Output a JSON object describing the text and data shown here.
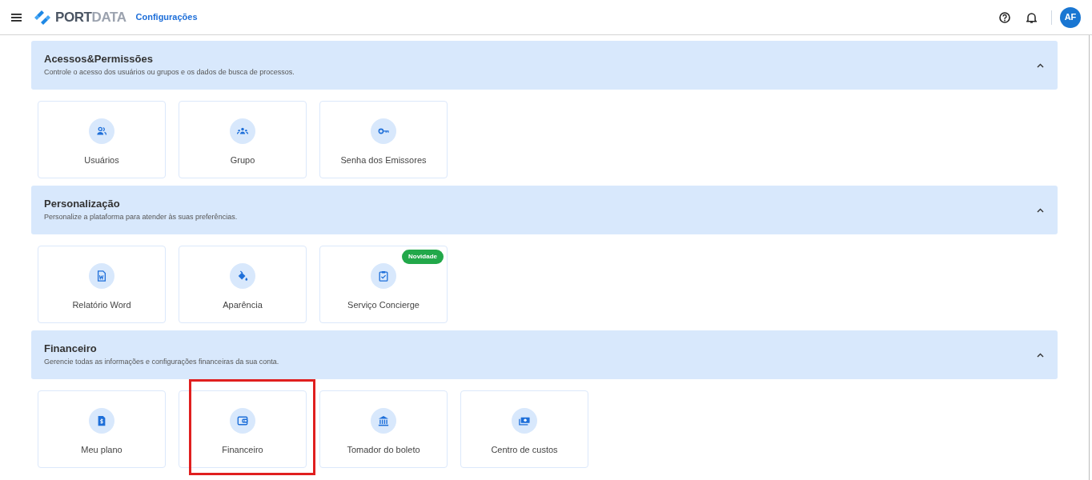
{
  "header": {
    "brand": "PORTDATA",
    "page_title": "Configurações",
    "avatar": "AF"
  },
  "sections": [
    {
      "title": "Acessos&Permissões",
      "subtitle": "Controle o acesso dos usuários ou grupos e os dados de busca de processos.",
      "expanded": true,
      "cards": [
        {
          "label": "Usuários",
          "highlighted": false
        },
        {
          "label": "Grupo",
          "highlighted": false
        },
        {
          "label": "Senha dos Emissores",
          "highlighted": false
        }
      ]
    },
    {
      "title": "Personalização",
      "subtitle": "Personalize a plataforma para atender às suas preferências.",
      "expanded": true,
      "cards": [
        {
          "label": "Relatório Word",
          "highlighted": false
        },
        {
          "label": "Aparência",
          "highlighted": false
        },
        {
          "label": "Serviço Concierge",
          "badge": "Novidade",
          "highlighted": false
        }
      ]
    },
    {
      "title": "Financeiro",
      "subtitle": "Gerencie todas as informações e configurações financeiras da sua conta.",
      "expanded": true,
      "cards": [
        {
          "label": "Meu plano",
          "highlighted": false
        },
        {
          "label": "Financeiro",
          "highlighted": true
        },
        {
          "label": "Tomador do boleto",
          "highlighted": false
        },
        {
          "label": "Centro de custos",
          "highlighted": false
        }
      ]
    }
  ]
}
